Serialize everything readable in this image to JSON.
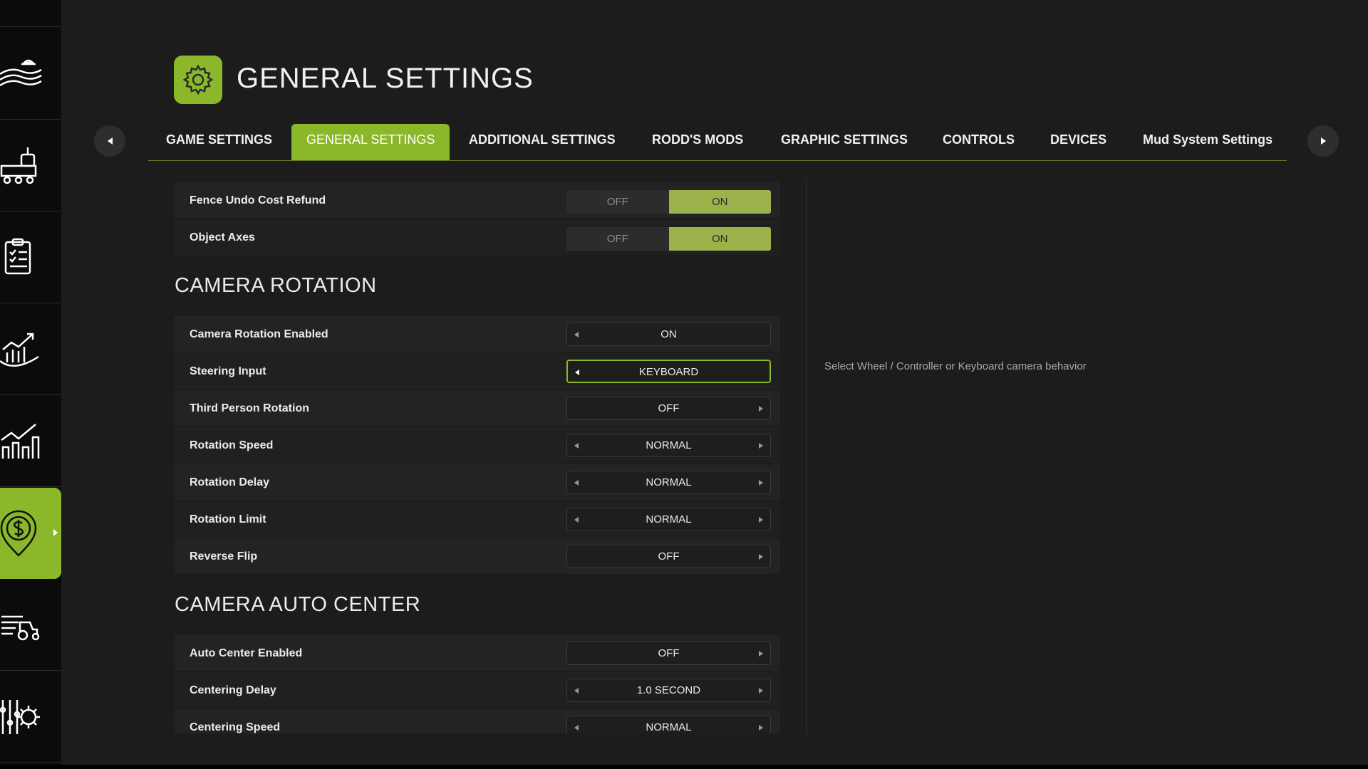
{
  "header": {
    "title": "GENERAL SETTINGS",
    "icon": "gear-icon",
    "accent": "#8bb82a"
  },
  "sidebar": {
    "items": [
      {
        "icon": "map-icon"
      },
      {
        "icon": "production-icon"
      },
      {
        "icon": "contracts-icon"
      },
      {
        "icon": "finances-icon"
      },
      {
        "icon": "statistics-icon"
      },
      {
        "icon": "money-pin-icon",
        "active": true
      },
      {
        "icon": "vehicles-icon"
      },
      {
        "icon": "settings-sliders-icon"
      }
    ]
  },
  "tabs": [
    {
      "label": "GAME SETTINGS"
    },
    {
      "label": "GENERAL SETTINGS",
      "active": true
    },
    {
      "label": "ADDITIONAL SETTINGS"
    },
    {
      "label": "RODD'S MODS"
    },
    {
      "label": "GRAPHIC SETTINGS"
    },
    {
      "label": "CONTROLS"
    },
    {
      "label": "DEVICES"
    },
    {
      "label": "Mud System Settings"
    }
  ],
  "top_rows": [
    {
      "label": "Fence Undo Cost Refund",
      "off": "OFF",
      "on": "ON",
      "value": "ON"
    },
    {
      "label": "Object Axes",
      "off": "OFF",
      "on": "ON",
      "value": "ON"
    }
  ],
  "sections": [
    {
      "title": "CAMERA ROTATION",
      "rows": [
        {
          "label": "Camera Rotation Enabled",
          "value": "ON"
        },
        {
          "label": "Steering Input",
          "value": "KEYBOARD"
        },
        {
          "label": "Third Person Rotation",
          "value": "OFF"
        },
        {
          "label": "Rotation Speed",
          "value": "NORMAL"
        },
        {
          "label": "Rotation Delay",
          "value": "NORMAL"
        },
        {
          "label": "Rotation Limit",
          "value": "NORMAL"
        },
        {
          "label": "Reverse Flip",
          "value": "OFF"
        }
      ]
    },
    {
      "title": "CAMERA AUTO CENTER",
      "rows": [
        {
          "label": "Auto Center Enabled",
          "value": "OFF"
        },
        {
          "label": "Centering Delay",
          "value": "1.0 SECOND"
        },
        {
          "label": "Centering Speed",
          "value": "NORMAL"
        }
      ]
    }
  ],
  "help": {
    "text": "Select Wheel / Controller or Keyboard camera behavior"
  }
}
